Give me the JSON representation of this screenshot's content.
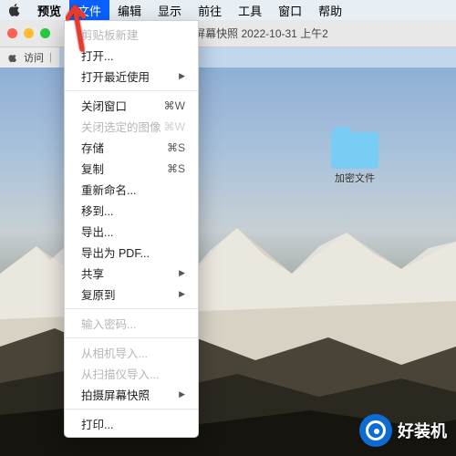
{
  "menubar": {
    "app": "预览",
    "items": [
      "文件",
      "编辑",
      "显示",
      "前往",
      "工具",
      "窗口",
      "帮助"
    ],
    "active_index": 0
  },
  "titlebar": {
    "filename": "屏幕快照 2022-10-31 上午2"
  },
  "toolbar": {
    "label": "访问"
  },
  "dropdown": {
    "groups": [
      [
        {
          "label": "剪贴板新建",
          "shortcut": "",
          "disabled": true,
          "submenu": false
        },
        {
          "label": "打开...",
          "shortcut": "",
          "disabled": false,
          "submenu": false
        },
        {
          "label": "打开最近使用",
          "shortcut": "",
          "disabled": false,
          "submenu": true
        }
      ],
      [
        {
          "label": "关闭窗口",
          "shortcut": "⌘W",
          "disabled": false,
          "submenu": false
        },
        {
          "label": "关闭选定的图像",
          "shortcut": "⌘W",
          "disabled": true,
          "submenu": false
        },
        {
          "label": "存储",
          "shortcut": "⌘S",
          "disabled": false,
          "submenu": false
        },
        {
          "label": "复制",
          "shortcut": "⌘S",
          "disabled": false,
          "submenu": false
        },
        {
          "label": "重新命名...",
          "shortcut": "",
          "disabled": false,
          "submenu": false
        },
        {
          "label": "移到...",
          "shortcut": "",
          "disabled": false,
          "submenu": false
        },
        {
          "label": "导出...",
          "shortcut": "",
          "disabled": false,
          "submenu": false
        },
        {
          "label": "导出为 PDF...",
          "shortcut": "",
          "disabled": false,
          "submenu": false
        },
        {
          "label": "共享",
          "shortcut": "",
          "disabled": false,
          "submenu": true
        },
        {
          "label": "复原到",
          "shortcut": "",
          "disabled": false,
          "submenu": true
        }
      ],
      [
        {
          "label": "输入密码...",
          "shortcut": "",
          "disabled": true,
          "submenu": false
        }
      ],
      [
        {
          "label": "从相机导入...",
          "shortcut": "",
          "disabled": true,
          "submenu": false
        },
        {
          "label": "从扫描仪导入...",
          "shortcut": "",
          "disabled": true,
          "submenu": false
        },
        {
          "label": "拍摄屏幕快照",
          "shortcut": "",
          "disabled": false,
          "submenu": true
        }
      ],
      [
        {
          "label": "打印...",
          "shortcut": "",
          "disabled": false,
          "submenu": false
        }
      ]
    ]
  },
  "desktop": {
    "folder_label": "加密文件"
  },
  "watermark": {
    "text": "好装机"
  }
}
